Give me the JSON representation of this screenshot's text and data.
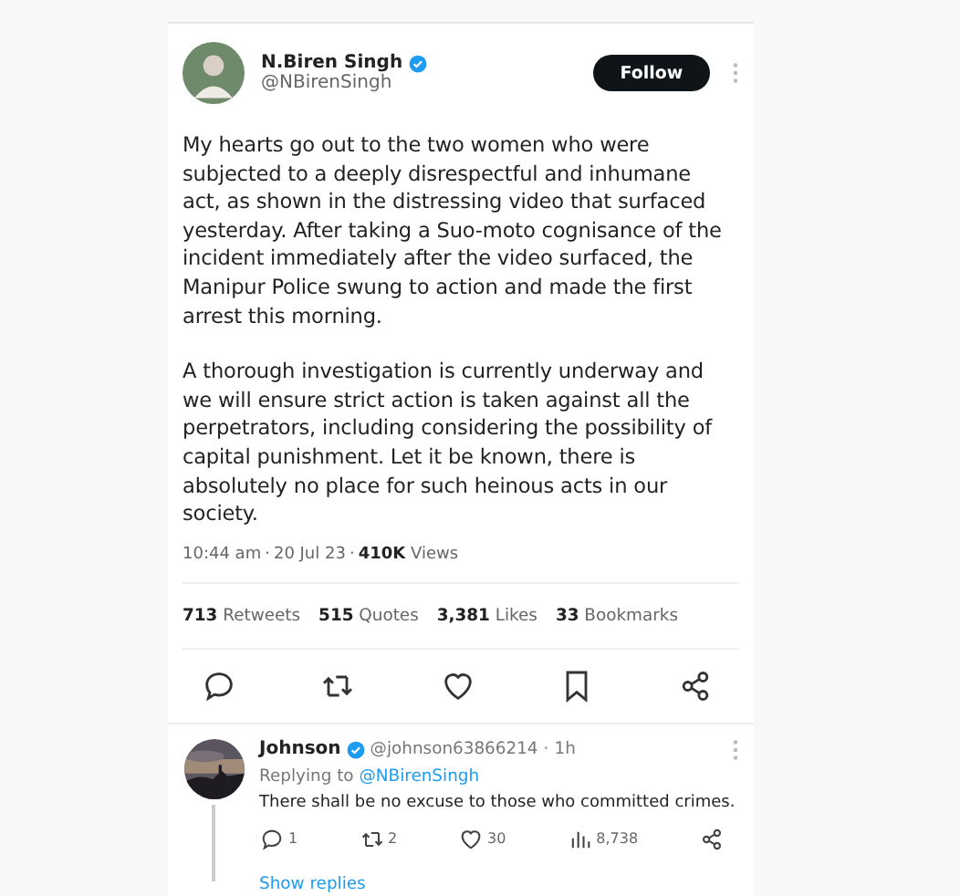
{
  "tweet": {
    "name": "N.Biren Singh",
    "verified": true,
    "handle": "@NBirenSingh",
    "follow_button": "Follow",
    "paragraphs": [
      "My hearts go out to the two women who were subjected to a deeply disrespectful and inhumane act, as shown in the distressing video that surfaced yesterday. After taking a Suo-moto cognisance of the incident immediately after the video surfaced, the Manipur Police swung to action and made the first arrest this morning.",
      "A thorough investigation is currently underway and we will ensure strict action is taken against all the perpetrators, including considering the possibility of capital punishment. Let it be known, there is absolutely no place for such heinous acts in our society."
    ],
    "separator": "·",
    "time": "10:44 am",
    "date": "20 Jul 23",
    "views_count": "410K",
    "views_label": "Views",
    "stats": [
      {
        "count": "713",
        "label": "Retweets"
      },
      {
        "count": "515",
        "label": "Quotes"
      },
      {
        "count": "3,381",
        "label": "Likes"
      },
      {
        "count": "33",
        "label": "Bookmarks"
      }
    ],
    "actions": [
      {
        "kind": "reply"
      },
      {
        "kind": "retweet"
      },
      {
        "kind": "like"
      },
      {
        "kind": "bookmark"
      },
      {
        "kind": "share"
      }
    ]
  },
  "reply": {
    "name": "Johnson",
    "verified": true,
    "handle": "@johnson63866214",
    "separator": "·",
    "age": "1h",
    "replying_label": "Replying to",
    "replying_handle": "@NBirenSingh",
    "text": "There shall be no excuse to those who committed crimes.",
    "actions": [
      {
        "kind": "reply",
        "count": "1"
      },
      {
        "kind": "retweet",
        "count": "2"
      },
      {
        "kind": "like",
        "count": "30"
      },
      {
        "kind": "views",
        "count": "8,738"
      },
      {
        "kind": "share"
      }
    ],
    "show_replies": "Show replies"
  }
}
